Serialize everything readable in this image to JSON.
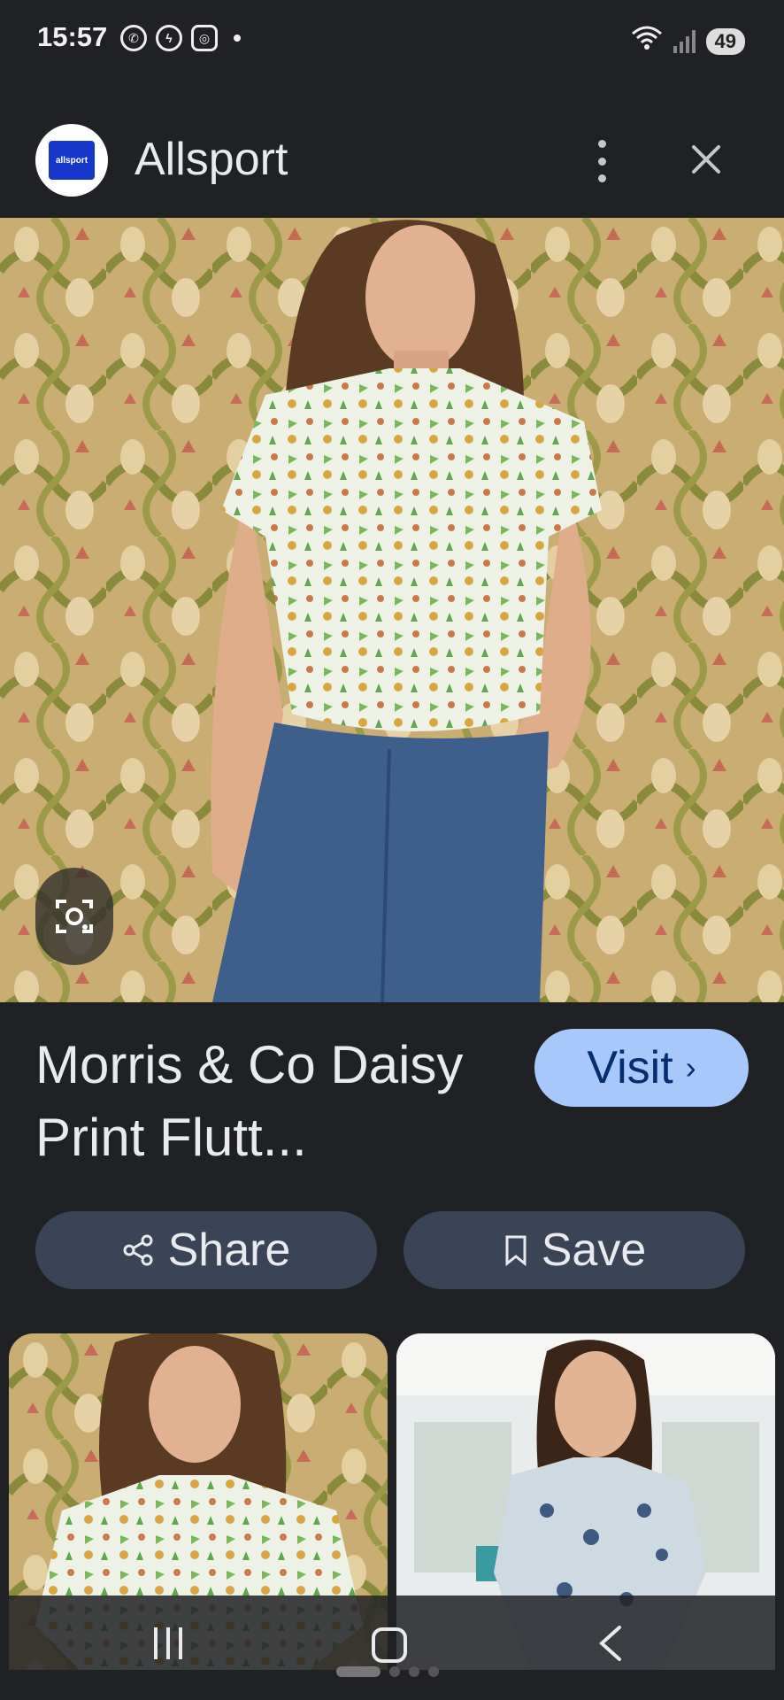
{
  "status_bar": {
    "time": "15:57",
    "apps": [
      "whatsapp-icon",
      "messenger-icon",
      "instagram-icon"
    ],
    "battery": "49",
    "wifi_label": "6"
  },
  "header": {
    "site_name": "Allsport",
    "logo_text": "allsport"
  },
  "product": {
    "title": "Morris & Co Daisy Print Flutt...",
    "visit_label": "Visit",
    "share_label": "Share",
    "save_label": "Save"
  },
  "colors": {
    "background": "#202124",
    "visit_button": "#a8c7fa",
    "pill_button": "#3b4456"
  }
}
